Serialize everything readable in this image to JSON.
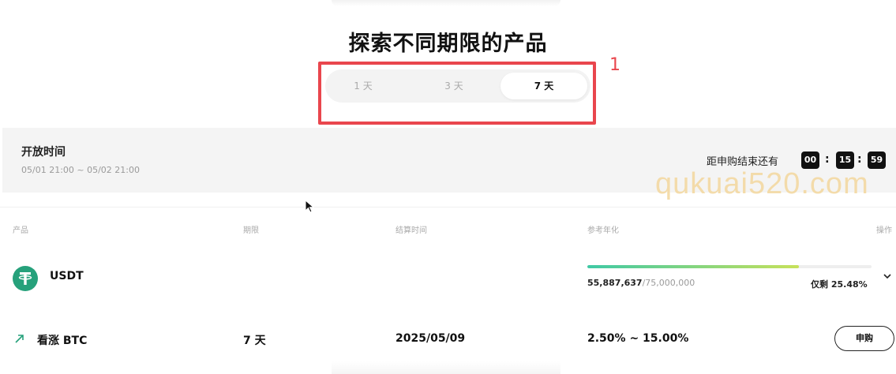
{
  "page": {
    "title": "探索不同期限的产品"
  },
  "tabs": [
    {
      "label": "1 天",
      "active": false
    },
    {
      "label": "3 天",
      "active": false
    },
    {
      "label": "7 天",
      "active": true
    }
  ],
  "annotation": {
    "number": "1",
    "color": "#e9464d"
  },
  "info": {
    "open_label": "开放时间",
    "open_range": "05/01 21:00 ~ 05/02 21:00",
    "countdown_label": "距申购结束还有",
    "countdown": {
      "hours": "00",
      "minutes": "15",
      "seconds": "59"
    }
  },
  "watermark": "qukuai520.com",
  "table": {
    "headers": {
      "product": "产品",
      "term": "期限",
      "settle": "结算时间",
      "apr": "参考年化",
      "action": "操作"
    }
  },
  "group": {
    "coin": "USDT",
    "coin_icon": "tether-icon",
    "coin_color": "#26a17b",
    "sold": "55,887,637",
    "total": "/75,000,000",
    "progress_percent": 74.5,
    "remaining": "仅剩 25.48%"
  },
  "rows": [
    {
      "name": "看涨 BTC",
      "icon": "trend-up-icon",
      "term": "7 天",
      "settle": "2025/05/09",
      "apr": "2.50% ~ 15.00%",
      "action_label": "申购"
    }
  ]
}
